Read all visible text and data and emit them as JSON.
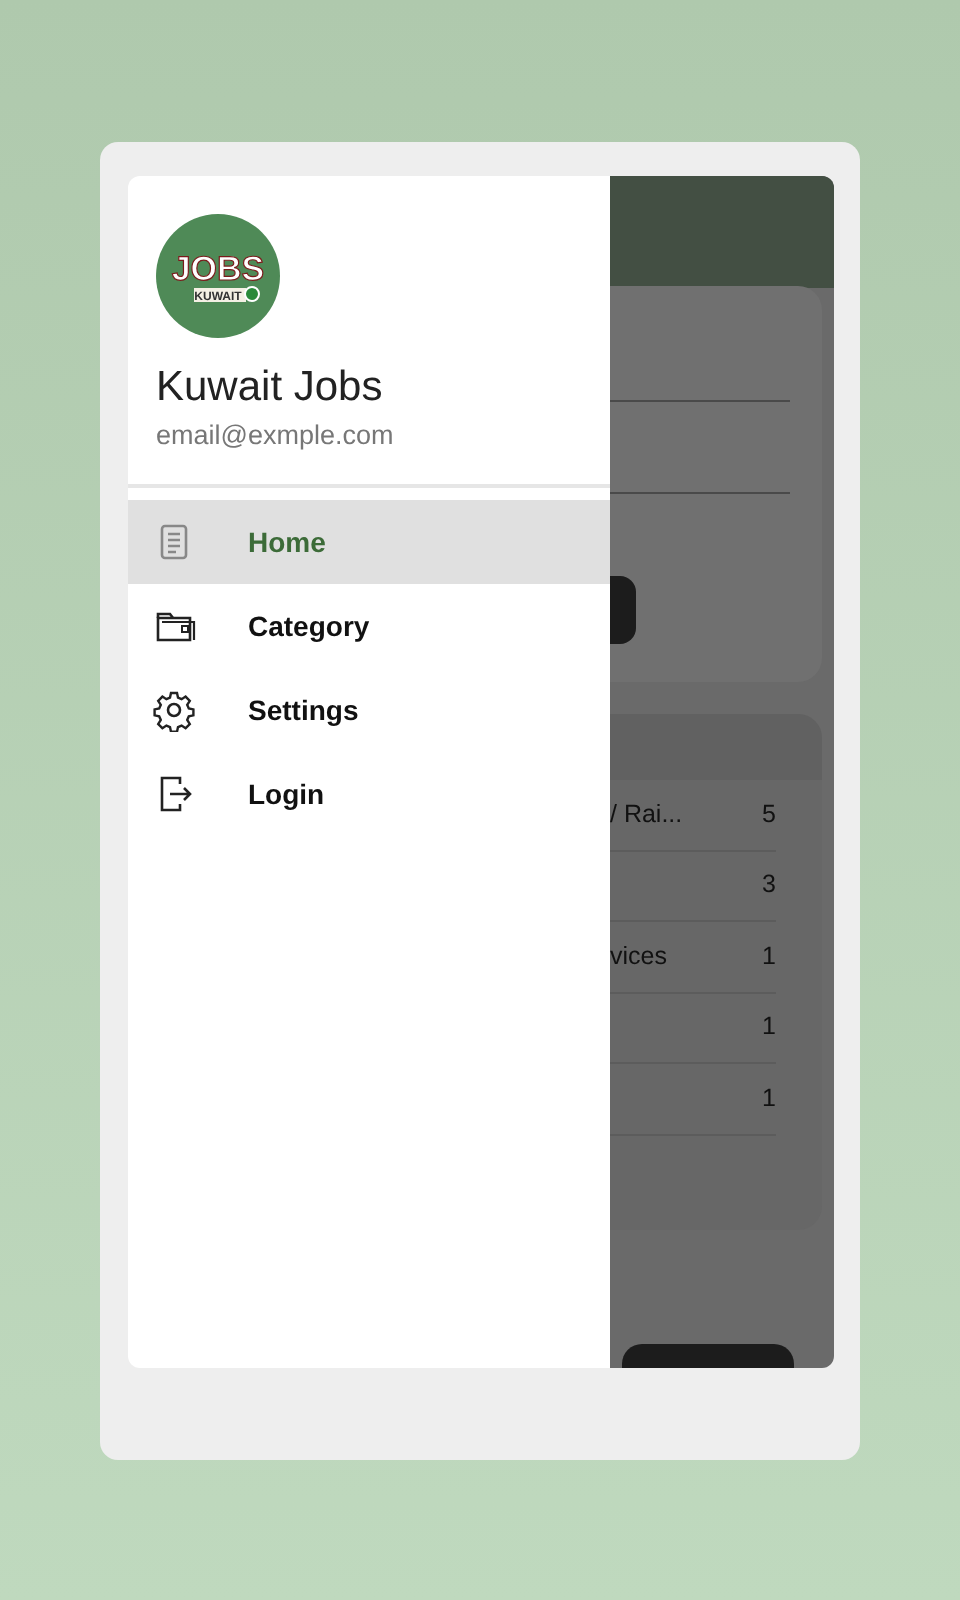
{
  "drawer": {
    "logo": {
      "text": "JOBS",
      "subtext": "KUWAIT"
    },
    "title": "Kuwait Jobs",
    "email": "email@exmple.com",
    "items": [
      {
        "label": "Home",
        "selected": true
      },
      {
        "label": "Category",
        "selected": false
      },
      {
        "label": "Settings",
        "selected": false
      },
      {
        "label": "Login",
        "selected": false
      }
    ]
  },
  "behind": {
    "rows": [
      {
        "label": "/ Rai...",
        "count": "5"
      },
      {
        "count": "3"
      },
      {
        "label": "vices",
        "count": "1"
      },
      {
        "count": "1"
      },
      {
        "count": "1"
      }
    ]
  }
}
